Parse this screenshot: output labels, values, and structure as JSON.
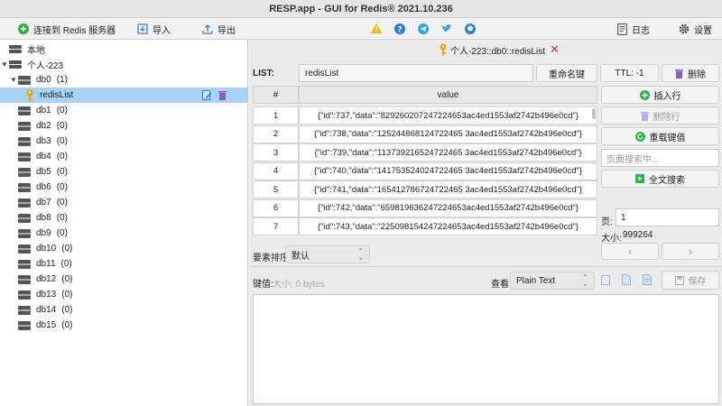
{
  "window": {
    "title": "RESP.app - GUI for Redis® 2021.10.236"
  },
  "toolbar": {
    "connect_label": "连接到 Redis 服务器",
    "import_label": "导入",
    "export_label": "导出",
    "log_label": "日志",
    "settings_label": "设置"
  },
  "tree": {
    "local_label": "本地",
    "connection_label": "个人-223",
    "dbs": [
      {
        "label": "db0",
        "count": "(1)"
      },
      {
        "label": "db1",
        "count": "(0)"
      },
      {
        "label": "db2",
        "count": "(0)"
      },
      {
        "label": "db3",
        "count": "(0)"
      },
      {
        "label": "db4",
        "count": "(0)"
      },
      {
        "label": "db5",
        "count": "(0)"
      },
      {
        "label": "db6",
        "count": "(0)"
      },
      {
        "label": "db7",
        "count": "(0)"
      },
      {
        "label": "db8",
        "count": "(0)"
      },
      {
        "label": "db9",
        "count": "(0)"
      },
      {
        "label": "db10",
        "count": "(0)"
      },
      {
        "label": "db11",
        "count": "(0)"
      },
      {
        "label": "db12",
        "count": "(0)"
      },
      {
        "label": "db13",
        "count": "(0)"
      },
      {
        "label": "db14",
        "count": "(0)"
      },
      {
        "label": "db15",
        "count": "(0)"
      }
    ],
    "key_label": "redisList"
  },
  "tab": {
    "label": "个人-223::db0::redisList"
  },
  "key": {
    "type_label": "LIST:",
    "name": "redisList",
    "rename_label": "重命名键",
    "ttl_label": "TTL:  -1",
    "delete_label": "删除"
  },
  "table": {
    "col_index": "#",
    "col_value": "value",
    "rows": [
      {
        "index": "1",
        "value": "{\"id\":737,\"data\":\"829260207247224653ac4ed1553af2742b496e0cd\"}"
      },
      {
        "index": "2",
        "value": "{\"id\":738,\"data\":\"125244868124722465 3ac4ed1553af2742b496e0cd\"}"
      },
      {
        "index": "3",
        "value": "{\"id\":739,\"data\":\"113739216524722465 3ac4ed1553af2742b496e0cd\"}"
      },
      {
        "index": "4",
        "value": "{\"id\":740,\"data\":\"141753524024722465 3ac4ed1553af2742b496e0cd\"}"
      },
      {
        "index": "5",
        "value": "{\"id\":741,\"data\":\"165412786724722465 3ac4ed1553af2742b496e0cd\"}"
      },
      {
        "index": "6",
        "value": "{\"id\":742,\"data\":\"659819636247224653ac4ed1553af2742b496e0cd\"}"
      },
      {
        "index": "7",
        "value": "{\"id\":743,\"data\":\"225098154247224653ac4ed1553af2742b496e0cd\"}"
      }
    ]
  },
  "side": {
    "insert_label": "插入行",
    "delete_row_label": "删除行",
    "reload_label": "重载键值",
    "search_placeholder": "页面搜索中...",
    "fulltext_label": "全文搜索",
    "page_label": "页:",
    "page_value": "1",
    "size_label": "大小:",
    "size_value": "999264",
    "prev_label": "‹",
    "next_label": "›"
  },
  "sort": {
    "label": "要素排序",
    "value": "默认"
  },
  "value_editor": {
    "key_value_label": "键值:",
    "size_text": "大小:  0 bytes",
    "view_label": "查看",
    "format_value": "Plain Text",
    "save_label": "保存"
  },
  "colors": {
    "selected": "#a9d2f7",
    "green": "#2eb14a",
    "purple": "#8c59d6",
    "red": "#e0322f"
  }
}
